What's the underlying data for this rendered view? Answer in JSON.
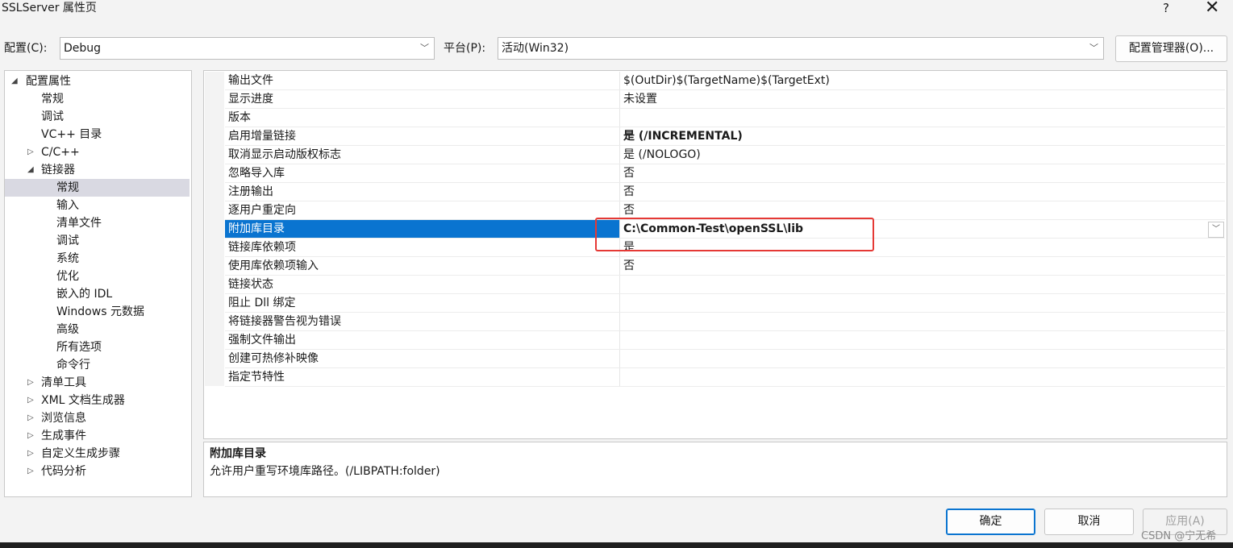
{
  "window": {
    "title": "SSLServer 属性页",
    "help_label": "?",
    "close_label": "✕"
  },
  "toolbar": {
    "config_label": "配置(C):",
    "config_value": "Debug",
    "platform_label": "平台(P):",
    "platform_value": "活动(Win32)",
    "config_manager_label": "配置管理器(O)..."
  },
  "tree": {
    "items": [
      {
        "label": "配置属性",
        "expander": "◢"
      },
      {
        "label": "常规"
      },
      {
        "label": "调试"
      },
      {
        "label": "VC++ 目录"
      },
      {
        "label": "C/C++",
        "expander": "▷"
      },
      {
        "label": "链接器",
        "expander": "◢"
      },
      {
        "label": "常规"
      },
      {
        "label": "输入"
      },
      {
        "label": "清单文件"
      },
      {
        "label": "调试"
      },
      {
        "label": "系统"
      },
      {
        "label": "优化"
      },
      {
        "label": "嵌入的 IDL"
      },
      {
        "label": "Windows 元数据"
      },
      {
        "label": "高级"
      },
      {
        "label": "所有选项"
      },
      {
        "label": "命令行"
      },
      {
        "label": "清单工具",
        "expander": "▷"
      },
      {
        "label": "XML 文档生成器",
        "expander": "▷"
      },
      {
        "label": "浏览信息",
        "expander": "▷"
      },
      {
        "label": "生成事件",
        "expander": "▷"
      },
      {
        "label": "自定义生成步骤",
        "expander": "▷"
      },
      {
        "label": "代码分析",
        "expander": "▷"
      }
    ]
  },
  "grid": {
    "rows": [
      {
        "name": "输出文件",
        "value": "$(OutDir)$(TargetName)$(TargetExt)"
      },
      {
        "name": "显示进度",
        "value": "未设置"
      },
      {
        "name": "版本",
        "value": ""
      },
      {
        "name": "启用增量链接",
        "value": "是 (/INCREMENTAL)"
      },
      {
        "name": "取消显示启动版权标志",
        "value": "是 (/NOLOGO)"
      },
      {
        "name": "忽略导入库",
        "value": "否"
      },
      {
        "name": "注册输出",
        "value": "否"
      },
      {
        "name": "逐用户重定向",
        "value": "否"
      },
      {
        "name": "附加库目录",
        "value": "C:\\Common-Test\\openSSL\\lib"
      },
      {
        "name": "链接库依赖项",
        "value": "是"
      },
      {
        "name": "使用库依赖项输入",
        "value": "否"
      },
      {
        "name": "链接状态",
        "value": ""
      },
      {
        "name": "阻止 Dll 绑定",
        "value": ""
      },
      {
        "name": "将链接器警告视为错误",
        "value": ""
      },
      {
        "name": "强制文件输出",
        "value": ""
      },
      {
        "name": "创建可热修补映像",
        "value": ""
      },
      {
        "name": "指定节特性",
        "value": ""
      }
    ]
  },
  "description": {
    "title": "附加库目录",
    "text": "允许用户重写环境库路径。(/LIBPATH:folder)"
  },
  "buttons": {
    "ok": "确定",
    "cancel": "取消",
    "apply": "应用(A)"
  },
  "watermark": "CSDN @宁无希",
  "colors": {
    "selection": "#0a74d0",
    "highlight_box": "#e53935",
    "tree_selection": "#d9d9e2"
  }
}
